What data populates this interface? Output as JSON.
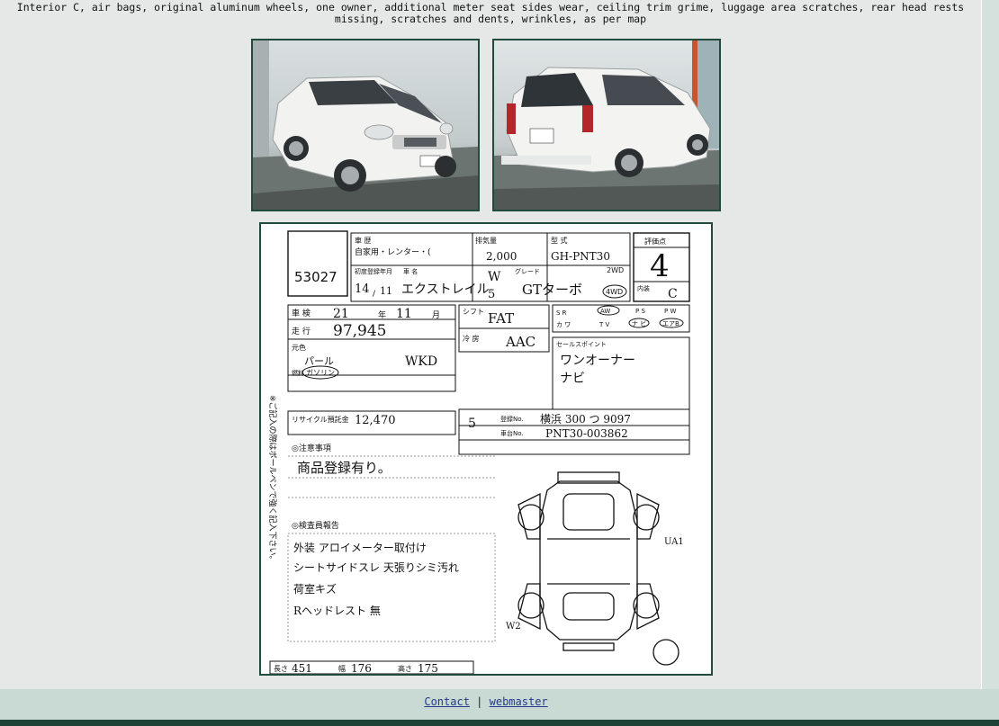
{
  "description": "Interior C, air bags, original aluminum wheels, one owner, additional meter seat sides wear, ceiling trim grime, luggage area scratches, rear head rests missing, scratches and dents, wrinkles, as per map",
  "sheet": {
    "lot_no": "53027",
    "type_code": "GH-PNT30",
    "displacement": "2,000",
    "grade": "4",
    "interior_grade": "C",
    "year": "14",
    "month": "11",
    "model_name": "エクストレイル",
    "grade_name": "GTターボ",
    "doors": "W",
    "seats_code": "5",
    "drive_2wd": "2WD",
    "drive_4wd": "4WD",
    "shaken_year": "21",
    "shaken_month": "11",
    "mileage": "97,945",
    "shift": "FAT",
    "ac": "AAC",
    "color": "パール",
    "color_code": "WKD",
    "fuel": "ガソリン",
    "recycle_fee": "12,470",
    "capacity": "5",
    "registration": "横浜 300 つ 9097",
    "chassis_no": "PNT30-003862",
    "sales_points": [
      "ワンオーナー",
      "ナビ"
    ],
    "notes": "商品登録有り。",
    "inspector_notes": [
      "外装 アロイメーター取付け",
      "シートサイドスレ 天張りシミ汚れ",
      "荷室キズ",
      "Rヘッドレスト 無"
    ],
    "dim_length": "451",
    "dim_width": "176",
    "dim_height": "175",
    "labels": {
      "seal_text": "評価点",
      "interior_text": "内装",
      "type_label": "型 式",
      "disp_label": "排気量",
      "category_label": "車 歴",
      "first_reg_label": "初度登録年月",
      "name_label": "車 名",
      "grade_label": "グレード",
      "shaken_label": "車 検",
      "mileage_label": "走 行",
      "shift_label": "シフト",
      "ac_label": "冷 房",
      "color_label": "元色",
      "fuel_label": "燃料",
      "recycle_label": "リサイクル預託金",
      "sales_label": "セールスポイント",
      "notes_label": "◎注意事項",
      "inspector_label": "◎検査員報告",
      "reg_label": "登録No.",
      "chassis_label": "車台No.",
      "length_label": "長さ",
      "width_label": "幅",
      "height_label": "高さ"
    }
  },
  "footer": {
    "contact": "Contact",
    "separator": "|",
    "webmaster": "webmaster"
  }
}
